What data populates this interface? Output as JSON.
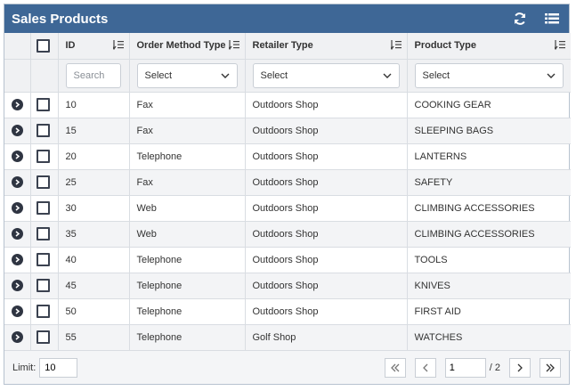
{
  "header": {
    "title": "Sales Products",
    "refresh_icon": "refresh-icon",
    "menu_icon": "list-icon"
  },
  "columns": [
    {
      "key": "id",
      "label": "ID"
    },
    {
      "key": "order_method",
      "label": "Order Method Type"
    },
    {
      "key": "retailer",
      "label": "Retailer Type"
    },
    {
      "key": "product",
      "label": "Product Type"
    }
  ],
  "filters": {
    "id_placeholder": "Search",
    "order_method_value": "Select",
    "retailer_value": "Select",
    "product_value": "Select"
  },
  "rows": [
    {
      "id": "10",
      "order_method": "Fax",
      "retailer": "Outdoors Shop",
      "product": "COOKING GEAR"
    },
    {
      "id": "15",
      "order_method": "Fax",
      "retailer": "Outdoors Shop",
      "product": "SLEEPING BAGS"
    },
    {
      "id": "20",
      "order_method": "Telephone",
      "retailer": "Outdoors Shop",
      "product": "LANTERNS"
    },
    {
      "id": "25",
      "order_method": "Fax",
      "retailer": "Outdoors Shop",
      "product": "SAFETY"
    },
    {
      "id": "30",
      "order_method": "Web",
      "retailer": "Outdoors Shop",
      "product": "CLIMBING ACCESSORIES"
    },
    {
      "id": "35",
      "order_method": "Web",
      "retailer": "Outdoors Shop",
      "product": "CLIMBING ACCESSORIES"
    },
    {
      "id": "40",
      "order_method": "Telephone",
      "retailer": "Outdoors Shop",
      "product": "TOOLS"
    },
    {
      "id": "45",
      "order_method": "Telephone",
      "retailer": "Outdoors Shop",
      "product": "KNIVES"
    },
    {
      "id": "50",
      "order_method": "Telephone",
      "retailer": "Outdoors Shop",
      "product": "FIRST AID"
    },
    {
      "id": "55",
      "order_method": "Telephone",
      "retailer": "Golf Shop",
      "product": "WATCHES"
    }
  ],
  "footer": {
    "limit_label": "Limit:",
    "limit_value": "10",
    "current_page": "1",
    "total_pages": "/ 2"
  },
  "colors": {
    "title_bar": "#3e6796",
    "header_bg": "#f0f1f3",
    "row_stripe": "#f3f4f6"
  }
}
